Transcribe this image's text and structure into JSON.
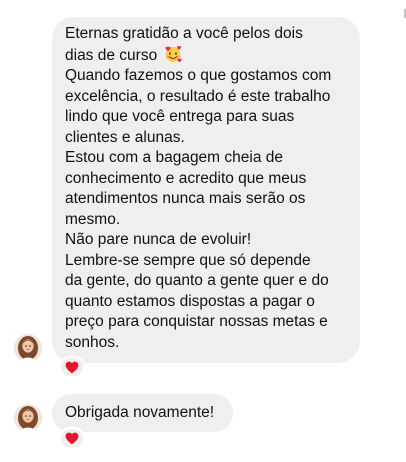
{
  "messages": [
    {
      "lines": [
        "Eternas gratidão a você pelos dois",
        "dias de curso",
        "Quando fazemos o que gostamos com",
        "excelência, o resultado é este trabalho",
        "lindo que você entrega para suas",
        "clientes e alunas.",
        "Estou com a bagagem cheia de",
        "conhecimento e acredito que meus",
        "atendimentos nunca mais serão os",
        "mesmo.",
        "Não pare nunca de evoluir!",
        "Lembre-se sempre que só depende",
        "da gente, do quanto a gente quer e do",
        "quanto estamos dispostas a pagar o",
        "preço para conquistar nossas metas e",
        "sonhos."
      ],
      "inline_emoji": "smiling-face-with-hearts",
      "reaction": "red-heart"
    },
    {
      "lines": [
        "Obrigada novamente!"
      ],
      "reaction": "red-heart"
    }
  ]
}
